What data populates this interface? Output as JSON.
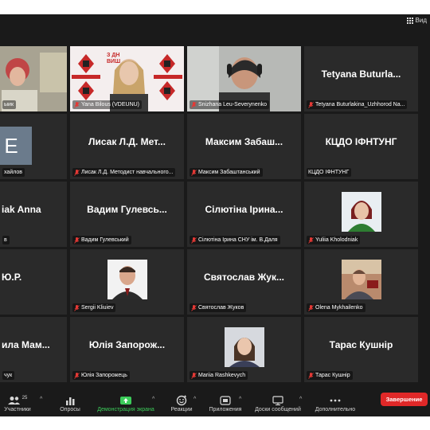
{
  "top_bar": {
    "view_label": "Вид"
  },
  "tiles": {
    "r1c1": {
      "caption": "ыик"
    },
    "r1c2": {
      "caption": "Yana Bilous (VDEUNU)",
      "banner_text": "З ДН",
      "banner_text2": "ВИШ"
    },
    "r1c3": {
      "caption": "Snizhana Leu-Severynenko"
    },
    "r1c4": {
      "display_name": "Tetyana Buturla...",
      "caption": "Tetyana Buturlakina_Uzhhorod Na..."
    },
    "r2c1": {
      "avatar_letter": "E",
      "caption": "хайлов"
    },
    "r2c2": {
      "display_name": "Лисак Л.Д. Мет...",
      "caption": "Лисак Л.Д. Методист навчального..."
    },
    "r2c3": {
      "display_name": "Максим Забаш...",
      "caption": "Максим Забаштанський"
    },
    "r2c4": {
      "display_name": "КЦДО ІФНТУНГ",
      "caption": "КЦДО ІФНТУНГ"
    },
    "r3c1": {
      "display_name": "iak Anna",
      "caption": "в"
    },
    "r3c2": {
      "display_name": "Вадим Гулевсь...",
      "caption": "Вадим Гулевський"
    },
    "r3c3": {
      "display_name": "Сілютіна Ірина...",
      "caption": "Сілютіна Ірина СНУ ім. В.Даля"
    },
    "r3c4": {
      "caption": "Yuliia Kholodniak"
    },
    "r4c1": {
      "display_name": "Ю.Р.",
      "caption": ""
    },
    "r4c2": {
      "caption": "Sergii Kliuiev"
    },
    "r4c3": {
      "display_name": "Святослав Жук...",
      "caption": "Святослав Жуков"
    },
    "r4c4": {
      "caption": "Olena Mykhailenko"
    },
    "r5c1": {
      "display_name": "ила Мам...",
      "caption": "чук"
    },
    "r5c2": {
      "display_name": "Юлія Запорож...",
      "caption": "Юлія Запорожець"
    },
    "r5c3": {
      "caption": "Mariia Rashkevych"
    },
    "r5c4": {
      "display_name": "Тарас Кушнір",
      "caption": "Тарас Кушнір"
    }
  },
  "toolbar": {
    "participants_label": "Участники",
    "participants_count": "25",
    "polls_label": "Опросы",
    "share_label": "Демонстрация экрана",
    "reactions_label": "Реакции",
    "apps_label": "Приложения",
    "whiteboards_label": "Доски сообщений",
    "more_label": "Дополнительно",
    "end_label": "Завершение"
  },
  "colors": {
    "end_button": "#e02828",
    "share_accent": "#3ccc5a",
    "mic_muted": "#e53935",
    "tile_bg": "#2a2a2a"
  }
}
